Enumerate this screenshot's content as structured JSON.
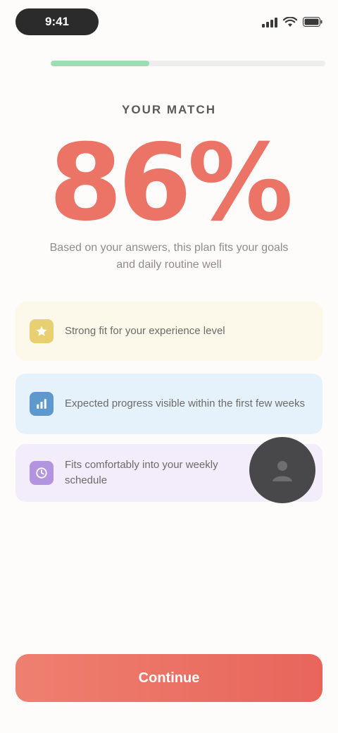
{
  "status_bar": {
    "time": "9:41"
  },
  "progress": {
    "value": 0.36
  },
  "result": {
    "eyebrow": "YOUR MATCH",
    "percent": "86%",
    "subtitle": "Based on your answers, this plan fits your goals and daily routine well"
  },
  "cards": [
    {
      "icon": "star-icon",
      "text": "Strong fit for your experience level",
      "color": "#e8cf72"
    },
    {
      "icon": "chart-icon",
      "text": "Expected progress visible within the first few weeks",
      "color": "#5f98cc"
    },
    {
      "icon": "clock-icon",
      "text": "Fits comfortably into your weekly schedule",
      "color": "#b294df"
    }
  ],
  "cta": {
    "label": "Continue"
  },
  "colors": {
    "accent": "#ec7466",
    "progress": "#9fdcb2",
    "avatar": "#48484a"
  }
}
